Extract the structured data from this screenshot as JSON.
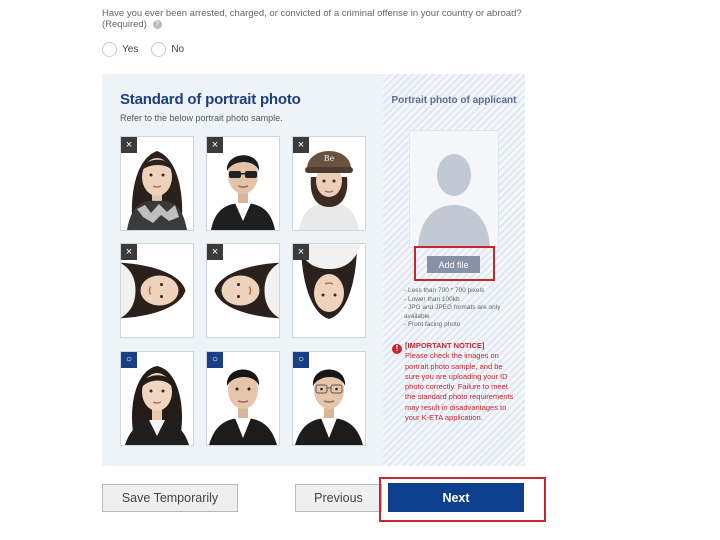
{
  "question": {
    "text": "Have you ever been arrested, charged, or convicted of a criminal offense in your country or abroad?",
    "required": "(Required)",
    "help_icon": "question-circle-icon",
    "options": [
      "Yes",
      "No"
    ]
  },
  "standard": {
    "title": "Standard of portrait photo",
    "subtitle": "Refer to the below portrait photo sample.",
    "rows": [
      [
        {
          "mark": "×",
          "status": "incorrect",
          "desc": "scarf-covering-chin"
        },
        {
          "mark": "×",
          "status": "incorrect",
          "desc": "sunglasses"
        },
        {
          "mark": "×",
          "status": "incorrect",
          "desc": "wearing-cap"
        }
      ],
      [
        {
          "mark": "×",
          "status": "incorrect",
          "desc": "rotated-left"
        },
        {
          "mark": "×",
          "status": "incorrect",
          "desc": "rotated-right"
        },
        {
          "mark": "×",
          "status": "incorrect",
          "desc": "upside-down"
        }
      ],
      [
        {
          "mark": "○",
          "status": "correct",
          "desc": "woman-front-facing"
        },
        {
          "mark": "○",
          "status": "correct",
          "desc": "man-front-facing"
        },
        {
          "mark": "○",
          "status": "correct",
          "desc": "man-with-glasses-front-facing"
        }
      ]
    ]
  },
  "applicant": {
    "title": "Portrait photo of applicant",
    "placeholder_icon": "person-silhouette-icon",
    "add_file_label": "Add file",
    "requirements": [
      "- Less than 700 * 700 pixels",
      "- Lower than 100kb",
      "- JPG and JPEG formats are only available",
      "- Front facing photo"
    ],
    "notice_icon": "exclamation-circle-icon",
    "notice_title": "[IMPORTANT NOTICE]",
    "notice_text": "Please check the images on portrait photo sample, and be sure you are uploading your ID photo correctly. Failure to meet the standard photo requirements may result in disadvantages to your K-ETA application."
  },
  "buttons": {
    "save": "Save Temporarily",
    "previous": "Previous",
    "next": "Next"
  },
  "colors": {
    "title_blue": "#1e3f7b",
    "next_blue": "#0d3f8c",
    "notice_red": "#c9252c",
    "panel_bg": "#eef3f8"
  }
}
